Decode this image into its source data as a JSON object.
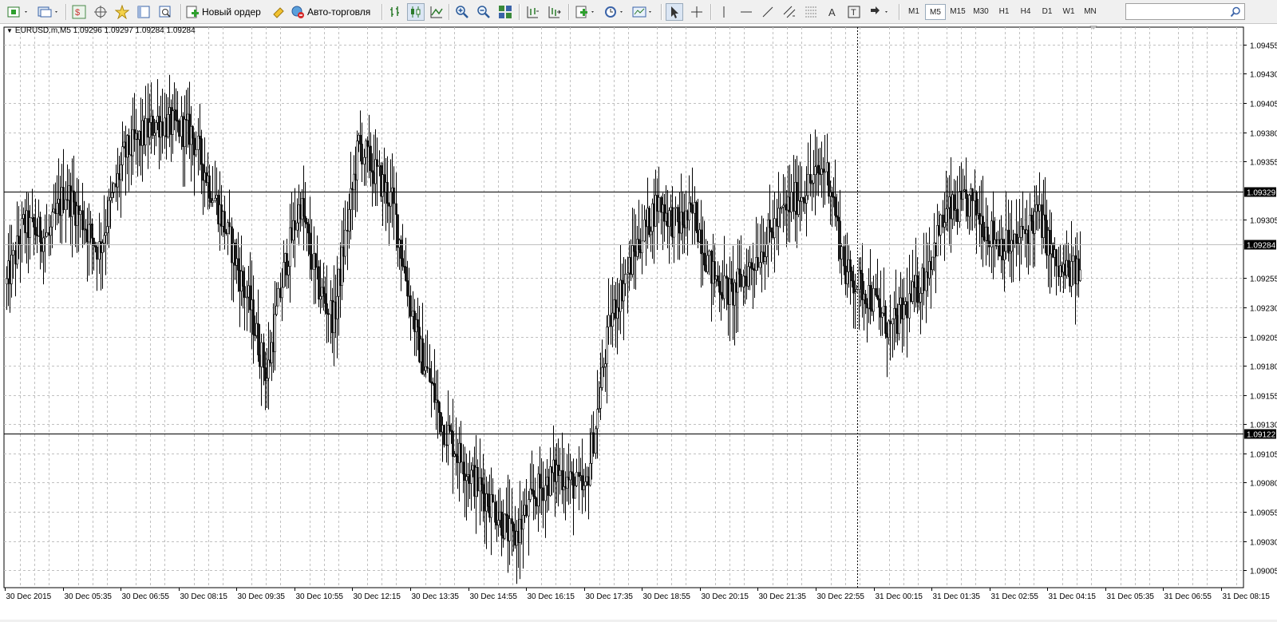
{
  "toolbar": {
    "new_order": "Новый ордер",
    "auto_trading": "Авто-торговля",
    "timeframes": [
      "M1",
      "M5",
      "M15",
      "M30",
      "H1",
      "H4",
      "D1",
      "W1",
      "MN"
    ],
    "active_timeframe": "M5",
    "search_value": ""
  },
  "chart": {
    "symbol_info": "EURUSD.m,M5  1.09296 1.09297 1.09284 1.09284",
    "price_ticks": [
      "1.09455",
      "1.09430",
      "1.09405",
      "1.09380",
      "1.09355",
      "1.09305",
      "1.09255",
      "1.09230",
      "1.09205",
      "1.09180",
      "1.09155",
      "1.09130",
      "1.09105",
      "1.09080",
      "1.09055",
      "1.09030",
      "1.09005"
    ],
    "time_labels": [
      "30 Dec 2015",
      "30 Dec 05:35",
      "30 Dec 06:55",
      "30 Dec 08:15",
      "30 Dec 09:35",
      "30 Dec 10:55",
      "30 Dec 12:15",
      "30 Dec 13:35",
      "30 Dec 14:55",
      "30 Dec 16:15",
      "30 Dec 17:35",
      "30 Dec 18:55",
      "30 Dec 20:15",
      "30 Dec 21:35",
      "30 Dec 22:55",
      "31 Dec 00:15",
      "31 Dec 01:35",
      "31 Dec 02:55",
      "31 Dec 04:15",
      "31 Dec 05:35",
      "31 Dec 06:55",
      "31 Dec 08:15"
    ],
    "hlines": [
      {
        "price": 1.09329,
        "label": "1.09329"
      },
      {
        "price": 1.09122,
        "label": "1.09122"
      }
    ],
    "current_price": {
      "price": 1.09284,
      "label": "1.09284"
    },
    "colors": {
      "grid": "#c0c0c0",
      "candle": "#000000",
      "bg": "#ffffff",
      "current_line": "#c0c0c0"
    }
  },
  "chart_data": {
    "type": "candlestick",
    "symbol": "EURUSD.m",
    "timeframe": "M5",
    "ylim": [
      1.0899,
      1.0947
    ],
    "anchors": [
      [
        0,
        1.0925
      ],
      [
        10,
        1.093
      ],
      [
        25,
        1.0929
      ],
      [
        35,
        1.0933
      ],
      [
        55,
        1.0928
      ],
      [
        70,
        1.0936
      ],
      [
        90,
        1.0939
      ],
      [
        110,
        1.0938
      ],
      [
        130,
        1.093
      ],
      [
        145,
        1.0923
      ],
      [
        155,
        1.0917
      ],
      [
        165,
        1.0926
      ],
      [
        175,
        1.0932
      ],
      [
        185,
        1.0925
      ],
      [
        195,
        1.0922
      ],
      [
        210,
        1.0937
      ],
      [
        230,
        1.0932
      ],
      [
        245,
        1.092
      ],
      [
        260,
        1.0913
      ],
      [
        275,
        1.0909
      ],
      [
        290,
        1.0906
      ],
      [
        302,
        1.0903
      ],
      [
        315,
        1.0907
      ],
      [
        328,
        1.0909
      ],
      [
        345,
        1.0907
      ],
      [
        360,
        1.0922
      ],
      [
        375,
        1.0928
      ],
      [
        388,
        1.0932
      ],
      [
        400,
        1.093
      ],
      [
        410,
        1.0931
      ],
      [
        420,
        1.0926
      ],
      [
        432,
        1.0924
      ],
      [
        450,
        1.0928
      ],
      [
        462,
        1.0931
      ],
      [
        475,
        1.0933
      ],
      [
        488,
        1.0935
      ],
      [
        492,
        1.0933
      ],
      [
        500,
        1.0926
      ],
      [
        515,
        1.0924
      ],
      [
        527,
        1.0921
      ],
      [
        545,
        1.0925
      ],
      [
        560,
        1.0931
      ],
      [
        575,
        1.0932
      ],
      [
        588,
        1.0929
      ],
      [
        600,
        1.0928
      ],
      [
        615,
        1.0931
      ],
      [
        627,
        1.0926
      ],
      [
        640,
        1.0926
      ]
    ]
  }
}
